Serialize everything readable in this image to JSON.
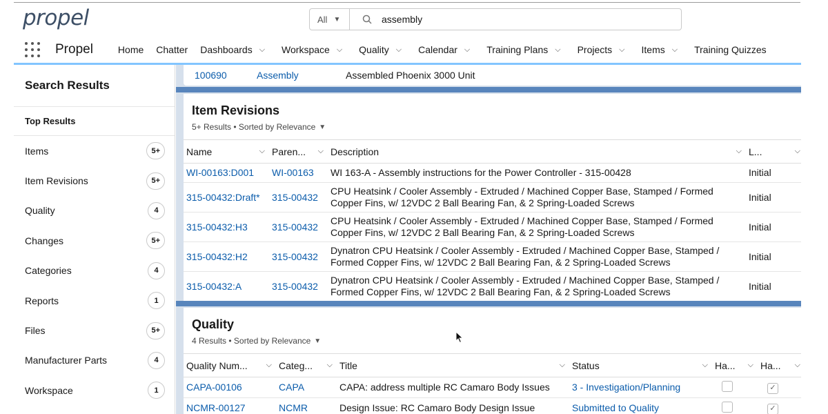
{
  "header": {
    "logo": "propel",
    "search_scope": "All",
    "search_value": "assembly"
  },
  "nav": {
    "app_name": "Propel",
    "items": [
      {
        "label": "Home",
        "dropdown": false
      },
      {
        "label": "Chatter",
        "dropdown": false
      },
      {
        "label": "Dashboards",
        "dropdown": true
      },
      {
        "label": "Workspace",
        "dropdown": true
      },
      {
        "label": "Quality",
        "dropdown": true
      },
      {
        "label": "Calendar",
        "dropdown": true
      },
      {
        "label": "Training Plans",
        "dropdown": true
      },
      {
        "label": "Projects",
        "dropdown": true
      },
      {
        "label": "Items",
        "dropdown": true
      },
      {
        "label": "Training Quizzes",
        "dropdown": false
      }
    ]
  },
  "sidebar": {
    "title": "Search Results",
    "top_results": "Top Results",
    "items": [
      {
        "label": "Items",
        "count": "5+"
      },
      {
        "label": "Item Revisions",
        "count": "5+"
      },
      {
        "label": "Quality",
        "count": "4"
      },
      {
        "label": "Changes",
        "count": "5+"
      },
      {
        "label": "Categories",
        "count": "4"
      },
      {
        "label": "Reports",
        "count": "1"
      },
      {
        "label": "Files",
        "count": "5+"
      },
      {
        "label": "Manufacturer Parts",
        "count": "4"
      },
      {
        "label": "Workspace",
        "count": "1"
      }
    ]
  },
  "items_partial_row": {
    "number": "100690",
    "category": "Assembly",
    "description": "Assembled Phoenix 3000 Unit"
  },
  "item_revisions": {
    "title": "Item Revisions",
    "subtitle": "5+ Results • Sorted by Relevance",
    "columns": [
      "Name",
      "Paren...",
      "Description",
      "L..."
    ],
    "rows": [
      {
        "name": "WI-00163:D001",
        "parent": "WI-00163",
        "description": "WI 163-A - Assembly instructions for the Power Controller - 315-00428",
        "lifecycle": "Initial"
      },
      {
        "name": "315-00432:Draft*",
        "parent": "315-00432",
        "description": "CPU Heatsink / Cooler Assembly - Extruded / Machined Copper Base, Stamped / Formed Copper Fins, w/ 12VDC 2 Ball Bearing Fan, & 2 Spring-Loaded Screws",
        "lifecycle": "Initial"
      },
      {
        "name": "315-00432:H3",
        "parent": "315-00432",
        "description": "CPU Heatsink / Cooler Assembly - Extruded / Machined Copper Base, Stamped / Formed Copper Fins, w/ 12VDC 2 Ball Bearing Fan, & 2 Spring-Loaded Screws",
        "lifecycle": "Initial"
      },
      {
        "name": "315-00432:H2",
        "parent": "315-00432",
        "description": "Dynatron CPU Heatsink / Cooler Assembly - Extruded / Machined Copper Base, Stamped / Formed Copper Fins, w/ 12VDC 2 Ball Bearing Fan, & 2 Spring-Loaded Screws",
        "lifecycle": "Initial"
      },
      {
        "name": "315-00432:A",
        "parent": "315-00432",
        "description": "Dynatron CPU Heatsink / Cooler Assembly - Extruded / Machined Copper Base, Stamped / Formed Copper Fins, w/ 12VDC 2 Ball Bearing Fan, & 2 Spring-Loaded Screws",
        "lifecycle": "Initial"
      }
    ]
  },
  "quality": {
    "title": "Quality",
    "subtitle": "4 Results • Sorted by Relevance",
    "columns": [
      "Quality Num...",
      "Categ...",
      "Title",
      "Status",
      "Ha...",
      "Ha..."
    ],
    "rows": [
      {
        "number": "CAPA-00106",
        "category": "CAPA",
        "title": "CAPA: address multiple RC Camaro Body Issues",
        "status": "3 - Investigation/Planning",
        "check1": false,
        "check2": true
      },
      {
        "number": "NCMR-00127",
        "category": "NCMR",
        "title": "Design Issue: RC Camaro Body Design Issue",
        "status": "Submitted to Quality",
        "check1": false,
        "check2": true
      }
    ]
  },
  "colors": {
    "link": "#0b5cab",
    "accent_band": "#4a7bb7",
    "page_bg": "#d6e0ec"
  }
}
